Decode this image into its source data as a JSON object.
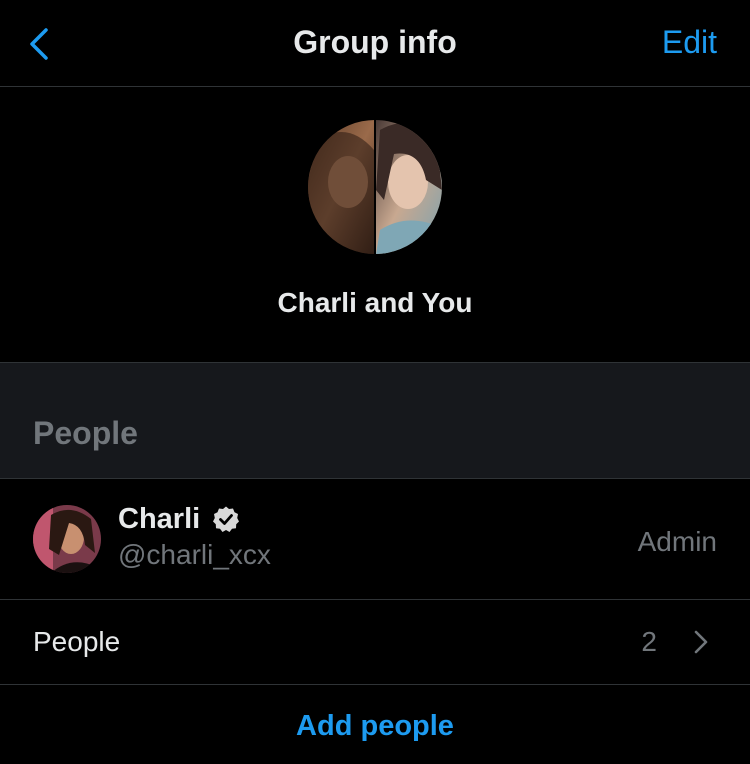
{
  "theme": {
    "background": "#000000",
    "accent": "#1d9bf0",
    "muted": "#71767b",
    "section_bg": "#16181c",
    "divider": "#2f3336"
  },
  "nav": {
    "back_icon": "chevron-left-icon",
    "title": "Group info",
    "edit_label": "Edit"
  },
  "group": {
    "name": "Charli and You",
    "avatar": "split-avatar-two-photos"
  },
  "people_section": {
    "title": "People"
  },
  "members": [
    {
      "name": "Charli",
      "handle": "@charli_xcx",
      "role": "Admin",
      "verified": true,
      "avatar": "profile-photo"
    }
  ],
  "people_row": {
    "label": "People",
    "count": "2",
    "icon": "chevron-right-icon"
  },
  "add_people_label": "Add people"
}
